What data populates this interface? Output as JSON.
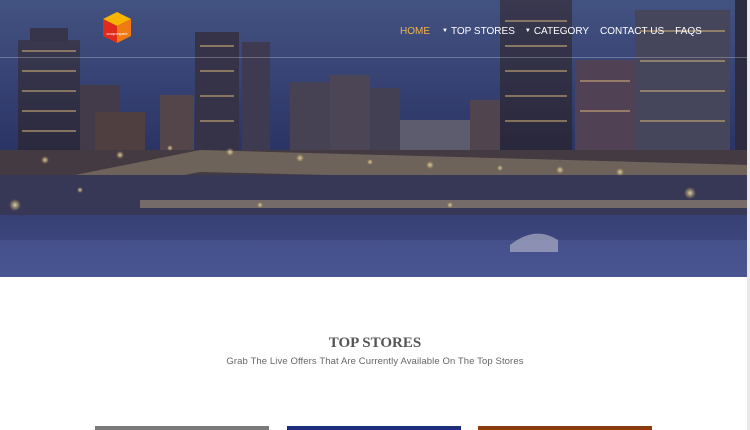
{
  "logo": {
    "text": "couponpark"
  },
  "nav": {
    "items": [
      {
        "label": "HOME",
        "active": true,
        "has_dropdown": false
      },
      {
        "label": "TOP STORES",
        "active": false,
        "has_dropdown": true
      },
      {
        "label": "CATEGORY",
        "active": false,
        "has_dropdown": true
      },
      {
        "label": "CONTACT US",
        "active": false,
        "has_dropdown": false
      },
      {
        "label": "FAQS",
        "active": false,
        "has_dropdown": false
      }
    ]
  },
  "section": {
    "title": "TOP STORES",
    "subtitle": "Grab The Live Offers That Are Currently Available On The Top Stores"
  },
  "cards": [
    {
      "accent": "#7a7a7a"
    },
    {
      "accent": "#1f2e7a"
    },
    {
      "accent": "#8a3b10"
    }
  ],
  "colors": {
    "nav_active": "#f2b248",
    "nav_text": "#ffffff",
    "hero_sky": "#2b3564"
  }
}
